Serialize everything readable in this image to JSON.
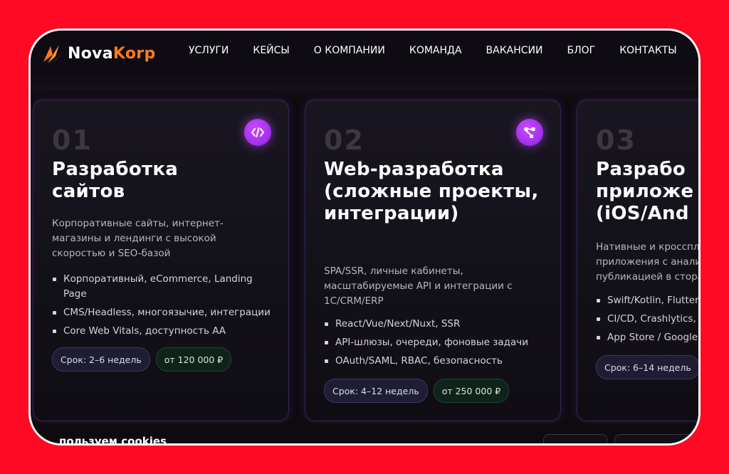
{
  "logo": {
    "part1": "Nova",
    "part2": "Korp"
  },
  "nav": [
    "УСЛУГИ",
    "КЕЙСЫ",
    "О КОМПАНИИ",
    "КОМАНДА",
    "ВАКАНСИИ",
    "БЛОГ",
    "КОНТАКТЫ"
  ],
  "cards": [
    {
      "num": "01",
      "icon": "code-icon",
      "title": "Разработка сайтов",
      "desc": "Корпоративные сайты, интернет-магазины и лендинги с высокой скоростью и SEO-базой",
      "features": [
        "Корпоративный, eCommerce, Landing Page",
        "CMS/Headless, многоязычие, интеграции",
        "Core Web Vitals, доступность AA"
      ],
      "term": "Срок: 2–6 недель",
      "price": "от 120 000 ₽"
    },
    {
      "num": "02",
      "icon": "share-nodes-icon",
      "title": "Web-разработка (сложные проекты, интеграции)",
      "desc": "SPA/SSR, личные кабинеты, масштабируемые API и интеграции с 1C/CRM/ERP",
      "features": [
        "React/Vue/Next/Nuxt, SSR",
        "API-шлюзы, очереди, фоновые задачи",
        "OAuth/SAML, RBAC, безопасность"
      ],
      "term": "Срок: 4–12 недель",
      "price": "от 250 000 ₽"
    },
    {
      "num": "03",
      "title": "Разрабо приложе (iOS/And",
      "desc": "Нативные и кроссплa приложения с аналит публикацией в стора",
      "features": [
        "Swift/Kotlin, Flutter",
        "CI/CD, Crashlytics, ",
        "App Store / Google "
      ],
      "term": "Срок: 6–14 недель"
    }
  ],
  "cookie": {
    "text": "пользуем cookies"
  }
}
